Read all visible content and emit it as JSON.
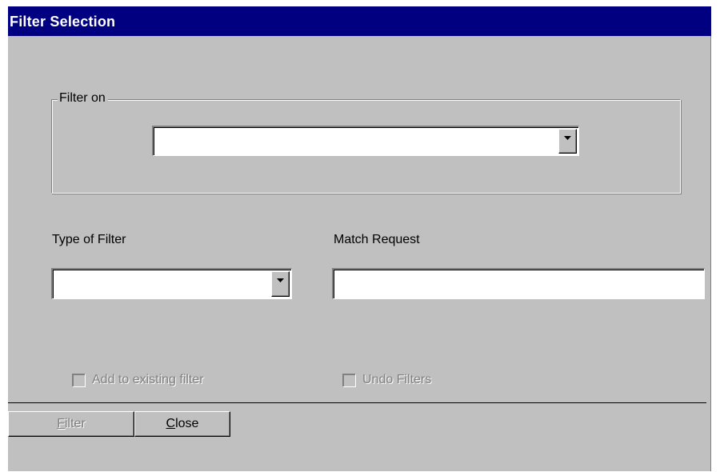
{
  "window": {
    "title": "Filter Selection"
  },
  "filter_on": {
    "group_label": "Filter on",
    "selected_value": ""
  },
  "type_of_filter": {
    "label": "Type of Filter",
    "selected_value": ""
  },
  "match_request": {
    "label": "Match Request",
    "value": ""
  },
  "checkboxes": {
    "add_to_existing": {
      "label": "Add to existing filter",
      "checked": false,
      "enabled": false
    },
    "undo_filters": {
      "label": "Undo Filters",
      "checked": false,
      "enabled": false
    }
  },
  "buttons": {
    "filter": {
      "label_mnemonic": "F",
      "label_rest": "ilter",
      "enabled": false
    },
    "close": {
      "label_mnemonic": "C",
      "label_rest": "lose",
      "enabled": true
    }
  },
  "icons": {
    "dropdown": "chevron-down-icon"
  },
  "colors": {
    "titlebar": "#000080",
    "face": "#c0c0c0"
  }
}
